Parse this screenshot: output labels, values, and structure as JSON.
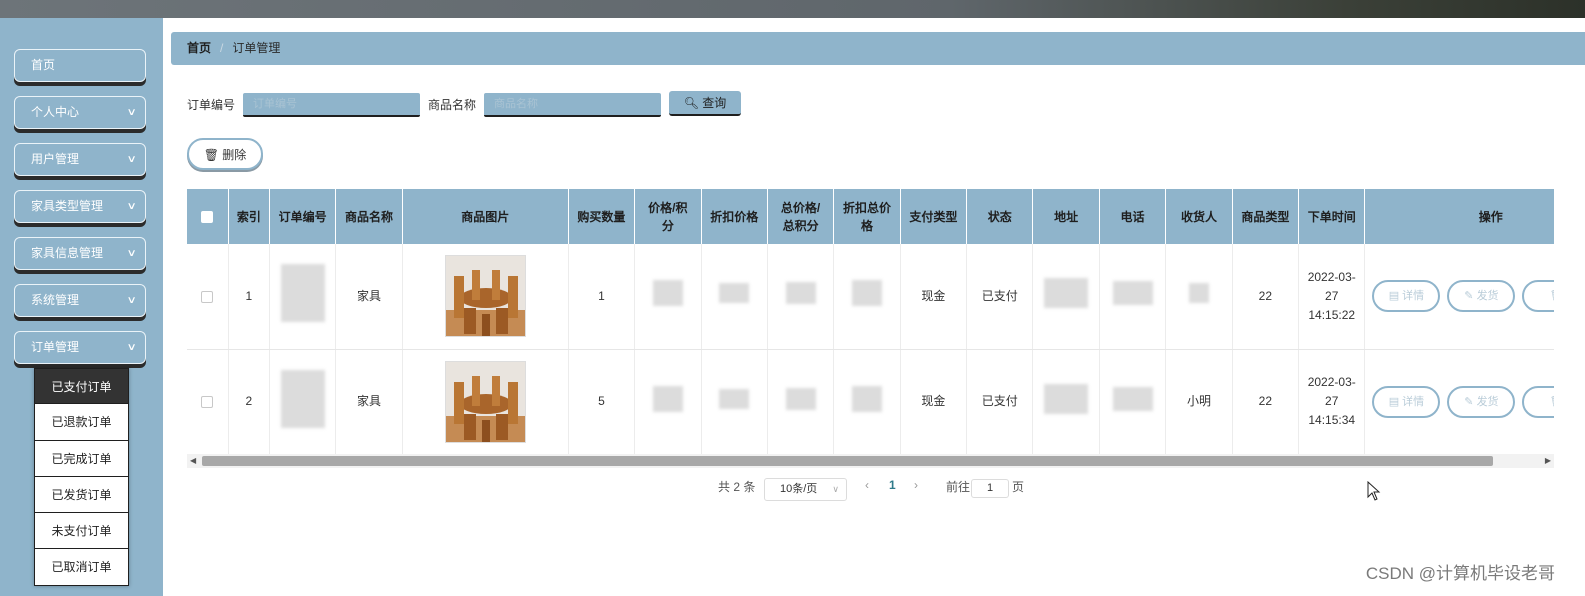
{
  "sidebar": {
    "items": [
      {
        "label": "首页"
      },
      {
        "label": "个人中心"
      },
      {
        "label": "用户管理"
      },
      {
        "label": "家具类型管理"
      },
      {
        "label": "家具信息管理"
      },
      {
        "label": "系统管理"
      },
      {
        "label": "订单管理"
      }
    ],
    "submenu": [
      {
        "label": "已支付订单"
      },
      {
        "label": "已退款订单"
      },
      {
        "label": "已完成订单"
      },
      {
        "label": "已发货订单"
      },
      {
        "label": "未支付订单"
      },
      {
        "label": "已取消订单"
      }
    ]
  },
  "breadcrumb": {
    "home": "首页",
    "current": "订单管理"
  },
  "search": {
    "order_no_label": "订单编号",
    "order_no_placeholder": "订单编号",
    "product_label": "商品名称",
    "product_placeholder": "商品名称",
    "query_label": "查询"
  },
  "actions": {
    "delete_label": "删除"
  },
  "table": {
    "headers": [
      "索引",
      "订单编号",
      "商品名称",
      "商品图片",
      "购买数量",
      "价格/积分",
      "折扣价格",
      "总价格/总积分",
      "折扣总价格",
      "支付类型",
      "状态",
      "地址",
      "电话",
      "收货人",
      "商品类型",
      "下单时间",
      "操作"
    ],
    "rows": [
      {
        "index": "1",
        "product": "家具",
        "quantity": "1",
        "pay_type": "现金",
        "status": "已支付",
        "receiver": "",
        "type": "22",
        "time": "2022-03-27 14:15:22"
      },
      {
        "index": "2",
        "product": "家具",
        "quantity": "5",
        "pay_type": "现金",
        "status": "已支付",
        "receiver": "小明",
        "type": "22",
        "time": "2022-03-27 14:15:34"
      }
    ],
    "row_actions": [
      "详情",
      "发货"
    ]
  },
  "pagination": {
    "total": "共 2 条",
    "page_size": "10条/页",
    "current_page": "1",
    "goto_label": "前往",
    "goto_value": "1",
    "page_suffix": "页"
  },
  "watermark": "CSDN @计算机毕设老哥",
  "colors": {
    "accent": "#8fb4cb",
    "dark": "#1f1f1f"
  }
}
